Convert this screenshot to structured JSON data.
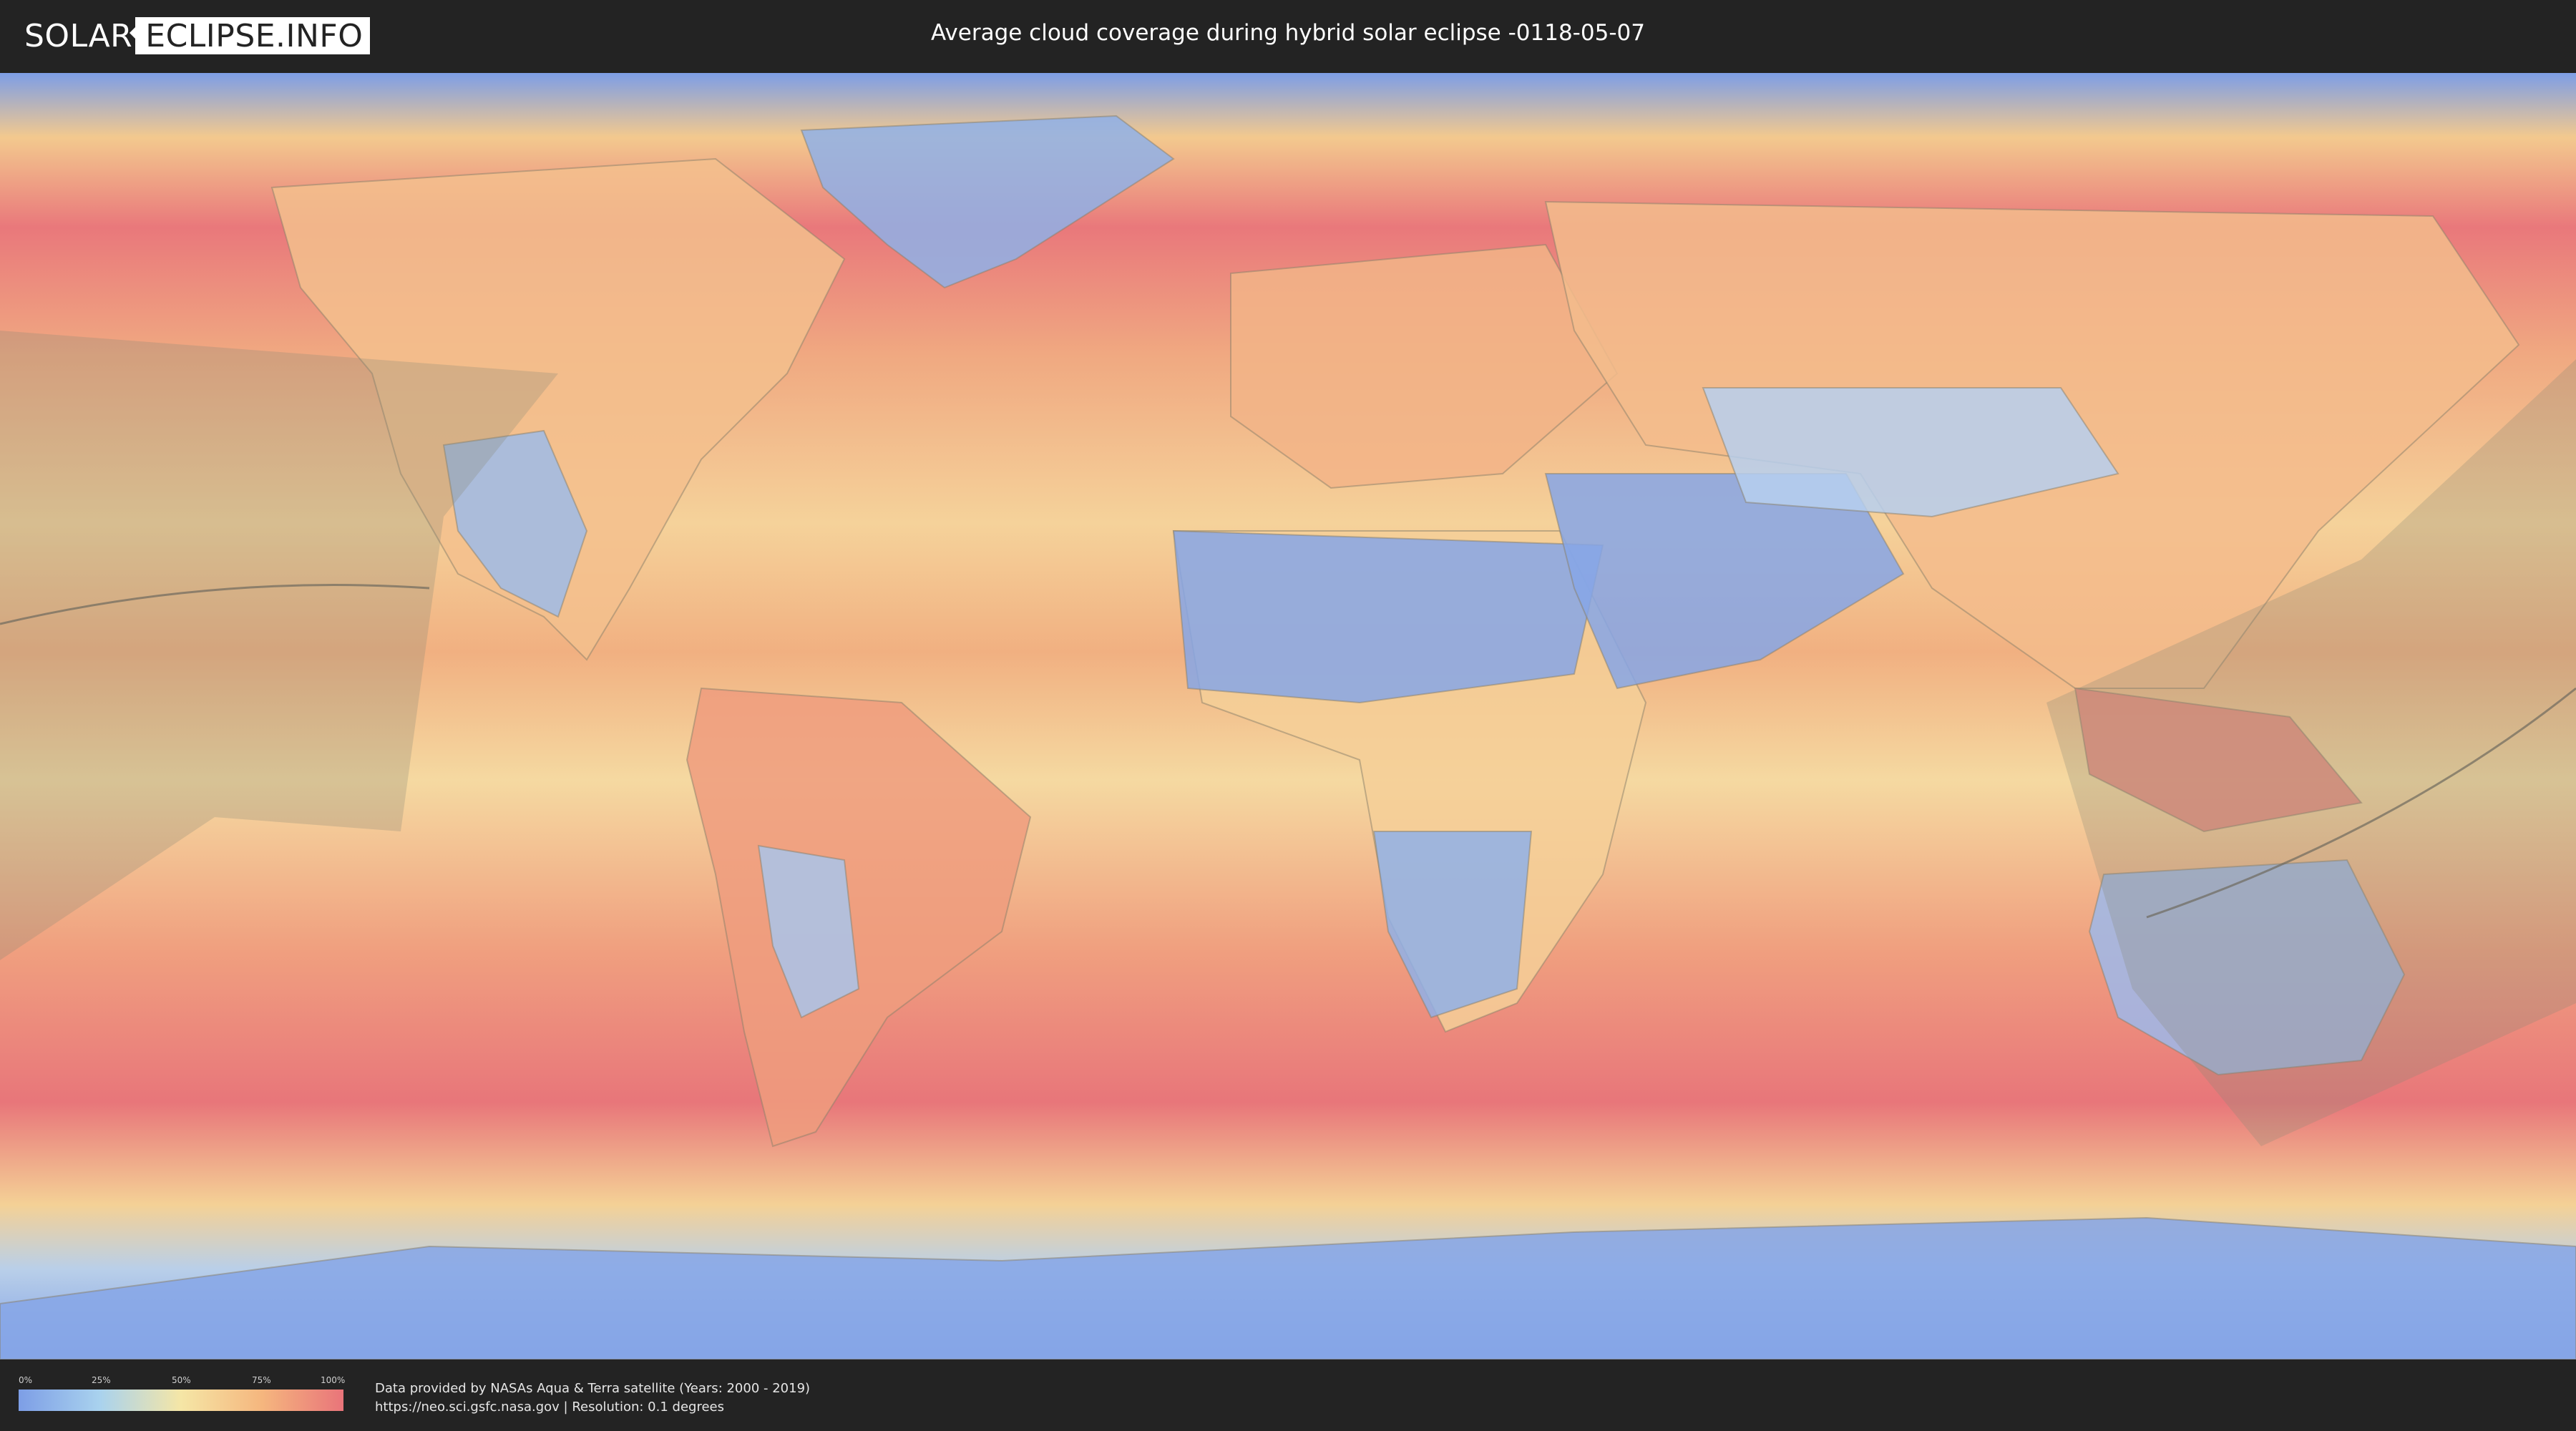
{
  "header": {
    "logo_left": "SOLAR",
    "logo_right": "ECLIPSE.INFO",
    "title": "Average cloud coverage during hybrid solar eclipse -0118-05-07"
  },
  "map": {
    "projection": "equirectangular world map",
    "colors": {
      "low_cloud": "#7d9ee6",
      "mid_low": "#a9d2ee",
      "mid": "#f5e6a6",
      "mid_high": "#f5b67e",
      "high_cloud": "#e9747a",
      "eclipse_overlay": "#8a8a78"
    }
  },
  "legend": {
    "ticks": [
      "0%",
      "25%",
      "50%",
      "75%",
      "100%"
    ]
  },
  "footer": {
    "credit_line1": "Data provided by NASAs Aqua & Terra satellite (Years: 2000 - 2019)",
    "credit_line2": "https://neo.sci.gsfc.nasa.gov | Resolution: 0.1 degrees"
  }
}
